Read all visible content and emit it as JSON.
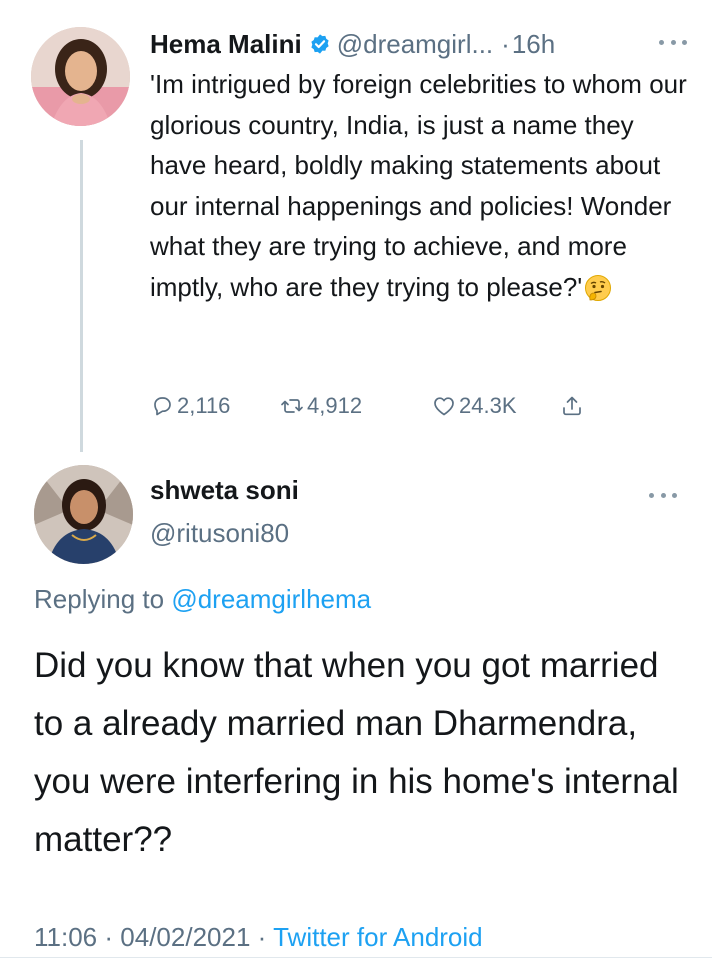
{
  "tweet1": {
    "author_name": "Hema Malini",
    "handle": "@dreamgirl...",
    "separator": "·",
    "time": "16h",
    "text": "'Im intrigued by foreign celebrities to whom our glorious country, India, is just a name they have heard, boldly making statements about our internal happenings and policies! Wonder what they are trying to achieve, and more imptly, who are they trying to please?'",
    "emoji_icon": "thinking-face-icon",
    "stats": {
      "replies": "2,116",
      "retweets": "4,912",
      "likes": "24.3K"
    }
  },
  "tweet2": {
    "author_name": "shweta soni",
    "handle": "@ritusoni80",
    "replying_prefix": "Replying to",
    "replying_to": "@dreamgirlhema",
    "text": "Did you know that when you got married to a already married man Dharmendra, you were interfering in his home's internal matter??",
    "time": "11:06",
    "date": "04/02/2021",
    "source": "Twitter for Android",
    "separator": "·"
  },
  "colors": {
    "text": "#14171a",
    "secondary": "#5b7083",
    "link": "#1da1f2",
    "verified": "#1da1f2",
    "thread_line": "#cfd9de"
  }
}
